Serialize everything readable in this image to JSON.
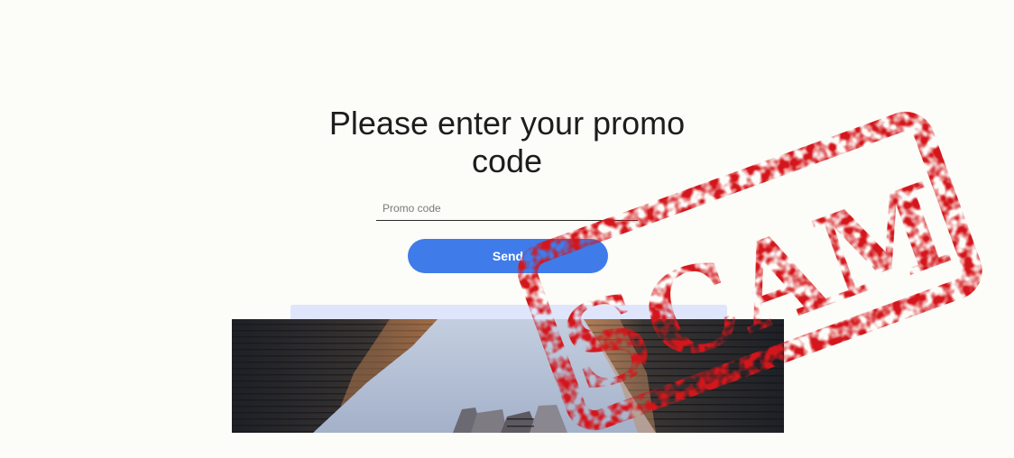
{
  "page": {
    "headline": "Please enter your promo code"
  },
  "form": {
    "promo_placeholder": "Promo code",
    "promo_value": "",
    "send_label": "Send"
  },
  "stamp": {
    "text": "SCAM",
    "color": "#d4161b"
  },
  "colors": {
    "background": "#fcfcf8",
    "button": "#3f7cea",
    "strip": "#dfe6fb"
  }
}
